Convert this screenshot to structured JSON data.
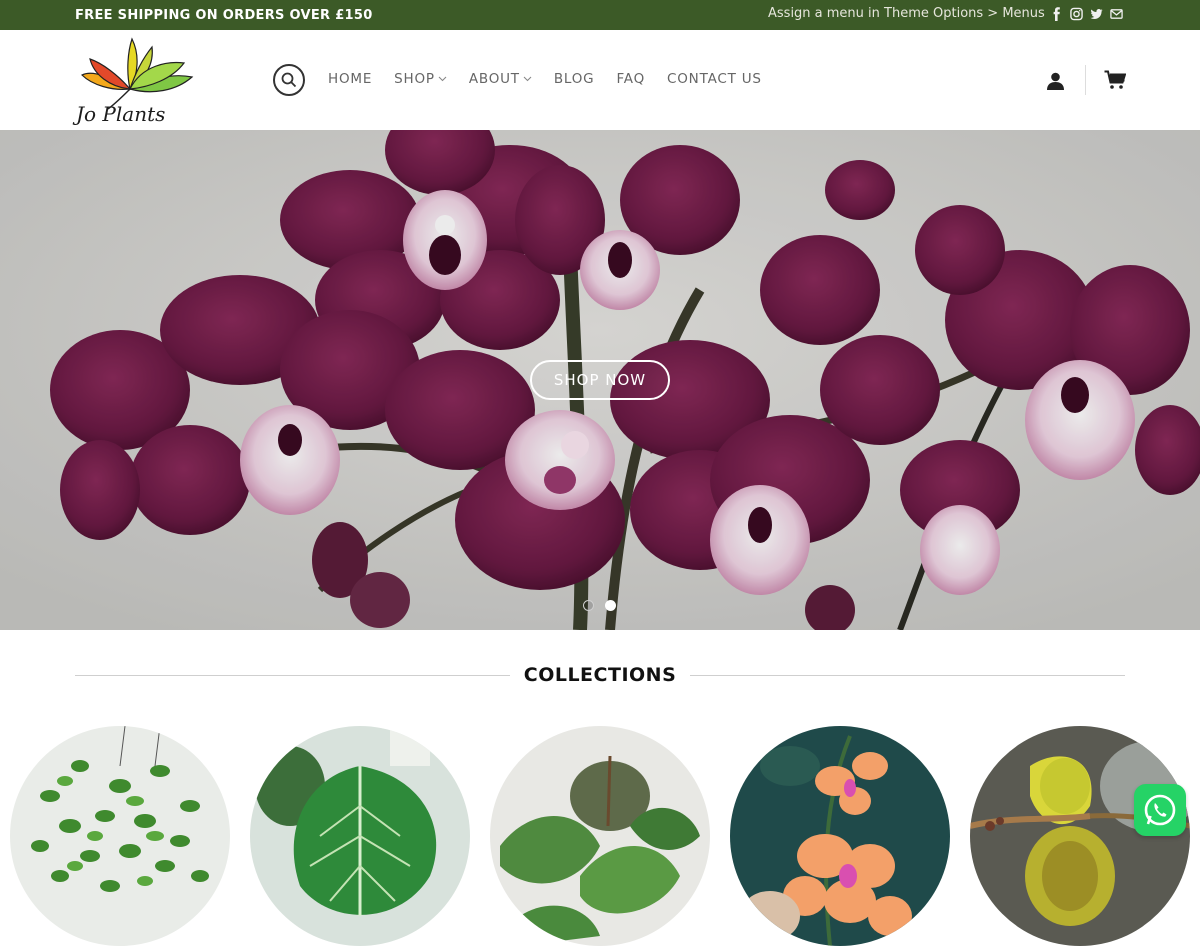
{
  "topbar": {
    "shipping_text": "FREE SHIPPING ON ORDERS OVER £150",
    "menu_note": "Assign a menu in Theme Options > Menus",
    "socials": [
      "facebook-icon",
      "instagram-icon",
      "twitter-icon",
      "email-icon"
    ],
    "bg_color": "#3c5a27"
  },
  "header": {
    "logo_text": "Jo Plants",
    "nav": [
      {
        "label": "HOME",
        "dropdown": false
      },
      {
        "label": "SHOP",
        "dropdown": true
      },
      {
        "label": "ABOUT",
        "dropdown": true
      },
      {
        "label": "BLOG",
        "dropdown": false
      },
      {
        "label": "FAQ",
        "dropdown": false
      },
      {
        "label": "CONTACT US",
        "dropdown": false
      }
    ]
  },
  "hero": {
    "button_label": "SHOP NOW",
    "slides": 2,
    "active_slide": 2
  },
  "collections": {
    "title": "COLLECTIONS",
    "items": [
      "hanging-plant",
      "philodendron",
      "pothos",
      "orchid",
      "slipper-orchid"
    ]
  },
  "whatsapp": {
    "icon": "whatsapp-icon",
    "color": "#25d366"
  }
}
